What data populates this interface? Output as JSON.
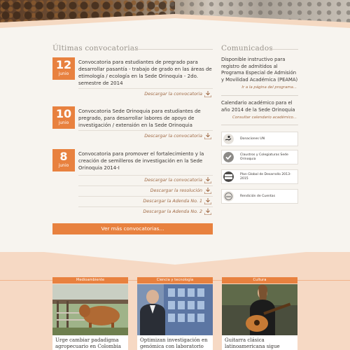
{
  "convocatorias": {
    "title": "Últimas convocatorias",
    "items": [
      {
        "day": "12",
        "month": "junio",
        "text": "Convocatoria para estudiantes de pregrado para desarrollar pasantía - trabajo de grado en las áreas de etimología / ecología en la Sede Orinoquia - 2do. semestre de 2014",
        "links": [
          "Descargar la convocatoria"
        ]
      },
      {
        "day": "10",
        "month": "junio",
        "text": "Convocatoria Sede Orinoquia para estudiantes de pregrado, para desarrollar labores de apoyo de investigación / extensión en la Sede Orinoquia",
        "links": [
          "Descargar la convocatoria"
        ]
      },
      {
        "day": "8",
        "month": "junio",
        "text": "Convocatoria para promover el fortalecimiento y la creación de semilleros de investigación en la Sede Orinoquia 2014-I",
        "links": [
          "Descargar la convocatoria",
          "Descargar la resolución",
          "Descargar la Adenda No. 1",
          "Descargar la Adenda No. 2"
        ]
      }
    ],
    "more_label": "Ver más convocatorias..."
  },
  "comunicados": {
    "title": "Comunicados",
    "items": [
      {
        "text": "Disponible instructivo para registro de admitidos al Programa Especial de Admisión y Movilidad Académica (PEAMA)",
        "link": "Ir a la página del programa..."
      },
      {
        "text": "Calendario académico para el año 2014 de la Sede Orinoquia",
        "link": "Consultar calendario académico..."
      }
    ]
  },
  "side_links": [
    {
      "label": "Donaciones UN",
      "icon": "donation-hand-icon"
    },
    {
      "label": "Claustros y Colegiaturas Sede Orinoquia",
      "icon": "checkmark-badge-icon"
    },
    {
      "label": "Plan Global de Desarrollo 2013-2015",
      "icon": "plan-2013-2015-icon"
    },
    {
      "label": "Rendición de Cuentas",
      "icon": "accountability-seal-icon"
    }
  ],
  "news_cards": [
    {
      "category": "Medioambiente",
      "caption": "Urge cambiar padadigma agropecuario en Colombia",
      "image": "cattle-photo"
    },
    {
      "category": "Ciencia y tecnología",
      "caption": "Optimizan investigación en genómica con laboratorio",
      "image": "laboratory-photo"
    },
    {
      "category": "Cultura",
      "caption": "Guitarra clásica latinoamericana sigue siendo",
      "image": "guitarist-photo"
    }
  ],
  "colors": {
    "accent": "#e8813f",
    "background": "#f6d9c4",
    "content_bg": "#f7f4ef",
    "link": "#a06a45"
  }
}
